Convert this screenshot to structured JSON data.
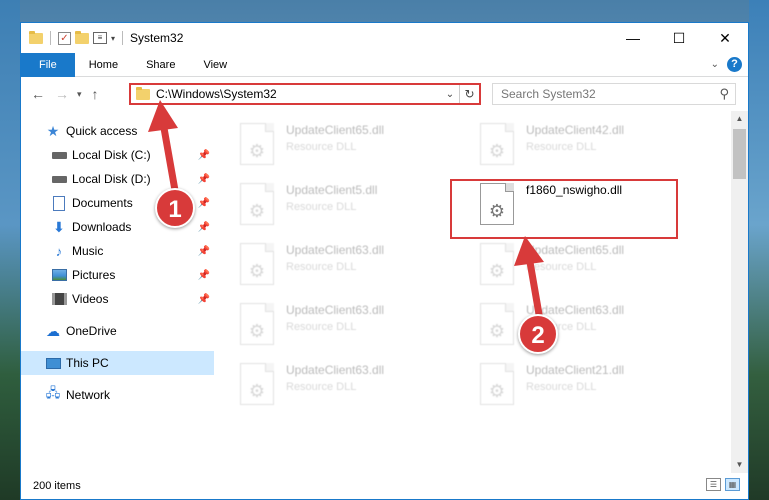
{
  "window": {
    "title": "System32",
    "controls": {
      "minimize": "—",
      "maximize": "☐",
      "close": "✕"
    }
  },
  "ribbon": {
    "tabs": [
      "File",
      "Home",
      "Share",
      "View"
    ]
  },
  "address": {
    "path": "C:\\Windows\\System32"
  },
  "search": {
    "placeholder": "Search System32"
  },
  "sidebar": {
    "quick_access": "Quick access",
    "pinned": [
      {
        "label": "Local Disk (C:)",
        "icon": "drive-icon"
      },
      {
        "label": "Local Disk (D:)",
        "icon": "drive-icon"
      },
      {
        "label": "Documents",
        "icon": "documents-icon"
      },
      {
        "label": "Downloads",
        "icon": "downloads-icon"
      },
      {
        "label": "Music",
        "icon": "music-icon"
      },
      {
        "label": "Pictures",
        "icon": "pictures-icon"
      },
      {
        "label": "Videos",
        "icon": "videos-icon"
      }
    ],
    "onedrive": "OneDrive",
    "this_pc": "This PC",
    "network": "Network"
  },
  "files": [
    {
      "name": "UpdateClient65.dll",
      "type": "Resource DLL"
    },
    {
      "name": "UpdateClient42.dll",
      "type": "Resource DLL"
    },
    {
      "name": "UpdateClient5.dll",
      "type": "Resource DLL"
    },
    {
      "name": "f1860_nswigho.dll",
      "type": ""
    },
    {
      "name": "UpdateClient63.dll",
      "type": "Resource DLL"
    },
    {
      "name": "UpdateClient65.dll",
      "type": "Resource DLL"
    },
    {
      "name": "UpdateClient63.dll",
      "type": "Resource DLL"
    },
    {
      "name": "UpdateClient63.dll",
      "type": "Resource DLL"
    },
    {
      "name": "UpdateClient63.dll",
      "type": "Resource DLL"
    },
    {
      "name": "UpdateClient21.dll",
      "type": "Resource DLL"
    }
  ],
  "status": {
    "item_count": "200 items"
  },
  "annotations": {
    "marker1": "1",
    "marker2": "2",
    "color": "#d83a3a"
  }
}
